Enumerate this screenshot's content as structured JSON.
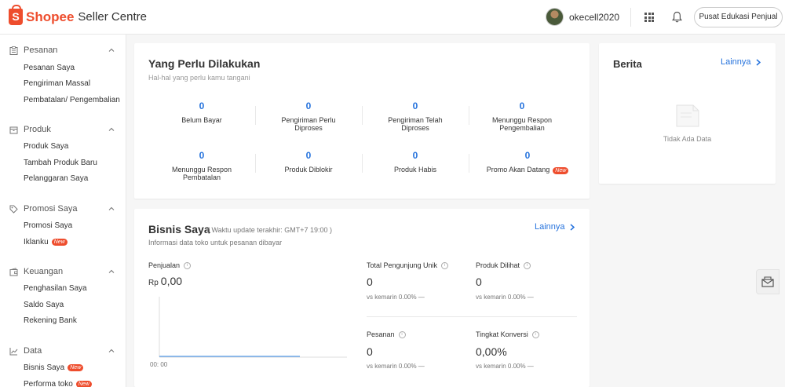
{
  "header": {
    "logo_brand": "Shopee",
    "logo_rest": "Seller Centre",
    "username": "okecell2020",
    "edu_button": "Pusat Edukasi Penjual"
  },
  "sidebar": {
    "sections": [
      {
        "title": "Pesanan",
        "icon": "clipboard-icon",
        "items": [
          {
            "label": "Pesanan Saya"
          },
          {
            "label": "Pengiriman Massal"
          },
          {
            "label": "Pembatalan/ Pengembalian"
          }
        ]
      },
      {
        "title": "Produk",
        "icon": "box-icon",
        "items": [
          {
            "label": "Produk Saya"
          },
          {
            "label": "Tambah Produk Baru"
          },
          {
            "label": "Pelanggaran Saya"
          }
        ]
      },
      {
        "title": "Promosi Saya",
        "icon": "tag-icon",
        "items": [
          {
            "label": "Promosi Saya"
          },
          {
            "label": "Iklanku",
            "badge": "New"
          }
        ]
      },
      {
        "title": "Keuangan",
        "icon": "wallet-icon",
        "items": [
          {
            "label": "Penghasilan Saya"
          },
          {
            "label": "Saldo Saya"
          },
          {
            "label": "Rekening Bank"
          }
        ]
      },
      {
        "title": "Data",
        "icon": "chart-icon",
        "items": [
          {
            "label": "Bisnis Saya",
            "badge": "New"
          },
          {
            "label": "Performa toko",
            "badge": "New"
          }
        ]
      }
    ]
  },
  "todo": {
    "title": "Yang Perlu Dilakukan",
    "subtitle": "Hal-hal yang perlu kamu tangani",
    "cells": [
      {
        "value": "0",
        "label": "Belum Bayar"
      },
      {
        "value": "0",
        "label": "Pengiriman Perlu Diproses"
      },
      {
        "value": "0",
        "label": "Pengiriman Telah Diproses"
      },
      {
        "value": "0",
        "label": "Menunggu Respon Pengembalian"
      },
      {
        "value": "0",
        "label": "Menunggu Respon Pembatalan"
      },
      {
        "value": "0",
        "label": "Produk Diblokir"
      },
      {
        "value": "0",
        "label": "Produk Habis"
      },
      {
        "value": "0",
        "label": "Promo Akan Datang",
        "badge": "New"
      }
    ]
  },
  "bisnis": {
    "title": "Bisnis Saya",
    "update_note": "( Waktu update terakhir: GMT+7 19:00 )",
    "subtitle": "Informasi data toko untuk pesanan dibayar",
    "more_label": "Lainnya",
    "sales_label": "Penjualan",
    "currency": "Rp",
    "sales_value": "0,00",
    "time_label": "00: 00",
    "metrics": [
      {
        "label": "Total Pengunjung Unik",
        "value": "0",
        "compare": "vs kemarin 0.00% —"
      },
      {
        "label": "Produk Dilihat",
        "value": "0",
        "compare": "vs kemarin 0.00% —"
      },
      {
        "label": "Pesanan",
        "value": "0",
        "compare": "vs kemarin 0.00% —"
      },
      {
        "label": "Tingkat Konversi",
        "value": "0,00%",
        "compare": "vs kemarin 0.00% —"
      }
    ]
  },
  "berita": {
    "title": "Berita",
    "more_label": "Lainnya",
    "empty_text": "Tidak Ada Data"
  },
  "colors": {
    "accent": "#ee4d2d",
    "link": "#2673dd"
  }
}
